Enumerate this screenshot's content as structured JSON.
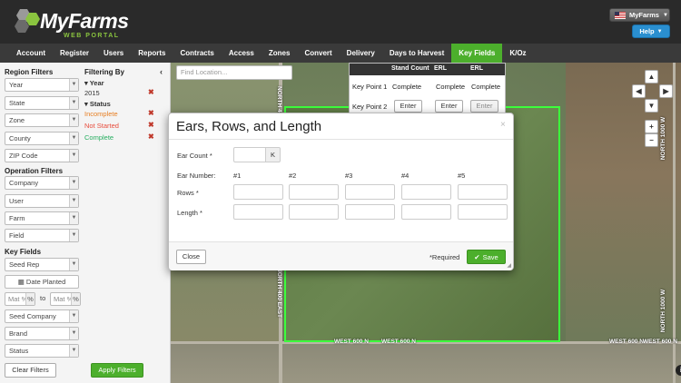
{
  "header": {
    "logo_text": "MyFarms",
    "logo_subtext": "WEB PORTAL",
    "user_button": "MyFarms",
    "help_button": "Help"
  },
  "nav": [
    "Account",
    "Register",
    "Users",
    "Reports",
    "Contracts",
    "Access",
    "Zones",
    "Convert",
    "Delivery",
    "Days to Harvest",
    "Key Fields",
    "K/Oz"
  ],
  "nav_active": "Key Fields",
  "sidebar": {
    "region_filters": "Region Filters",
    "region_selects": [
      "Year",
      "State",
      "Zone",
      "County",
      "ZIP Code"
    ],
    "operation_filters": "Operation Filters",
    "operation_selects": [
      "Company",
      "User",
      "Farm",
      "Field"
    ],
    "key_fields": "Key Fields",
    "seed_rep": "Seed Rep",
    "date_planted": "Date Planted",
    "mat_from_placeholder": "Mat %",
    "mat_to_label": "to",
    "mat_to_placeholder": "Mat %",
    "mat_suffix": "%",
    "key_selects_2": [
      "Seed Company",
      "Brand",
      "Status"
    ],
    "clear_button": "Clear Filters",
    "apply_button": "Apply Filters"
  },
  "filtering_by": {
    "title": "Filtering By",
    "year_label": "Year",
    "year_value": "2015",
    "status_label": "Status",
    "statuses": [
      {
        "text": "Incomplete",
        "color": "#e67e22"
      },
      {
        "text": "Not Started",
        "color": "#e74c3c"
      },
      {
        "text": "Complete",
        "color": "#27ae60"
      }
    ]
  },
  "map": {
    "search_placeholder": "Find Location...",
    "road_labels": [
      "WEST 600 N",
      "WEST 600 N",
      "WEST 600 N",
      "WEST 600 N",
      "NORTH 1000 W",
      "NORTH 1000 W",
      "NORTH 400 EAST",
      "NORTH 400 EAST"
    ],
    "key_points": {
      "headers": [
        "Stand Count",
        "ERL",
        "ERL"
      ],
      "row1_label": "Key Point 1",
      "row1_values": [
        "Complete",
        "Complete",
        "Complete"
      ],
      "row2_label": "Key Point 2",
      "row2_buttons": [
        "Enter",
        "Enter",
        "Enter"
      ]
    },
    "controls": [
      "▲",
      "◀",
      "▶",
      "▼",
      "+",
      "−"
    ]
  },
  "modal": {
    "title": "Ears, Rows, and Length",
    "close": "×",
    "ear_count_label": "Ear Count *",
    "ear_count_suffix": "K",
    "ear_number_label": "Ear Number:",
    "ear_numbers": [
      "#1",
      "#2",
      "#3",
      "#4",
      "#5"
    ],
    "rows_label": "Rows *",
    "length_label": "Length *",
    "close_button": "Close",
    "required_text": "*Required",
    "save_button": "Save"
  },
  "colors": {
    "accent": "#4caf2c",
    "header_bg": "#2a2a2a",
    "nav_bg": "#3a3a3a",
    "help_blue": "#2a8fd0",
    "field_outline": "#3cff3c"
  }
}
